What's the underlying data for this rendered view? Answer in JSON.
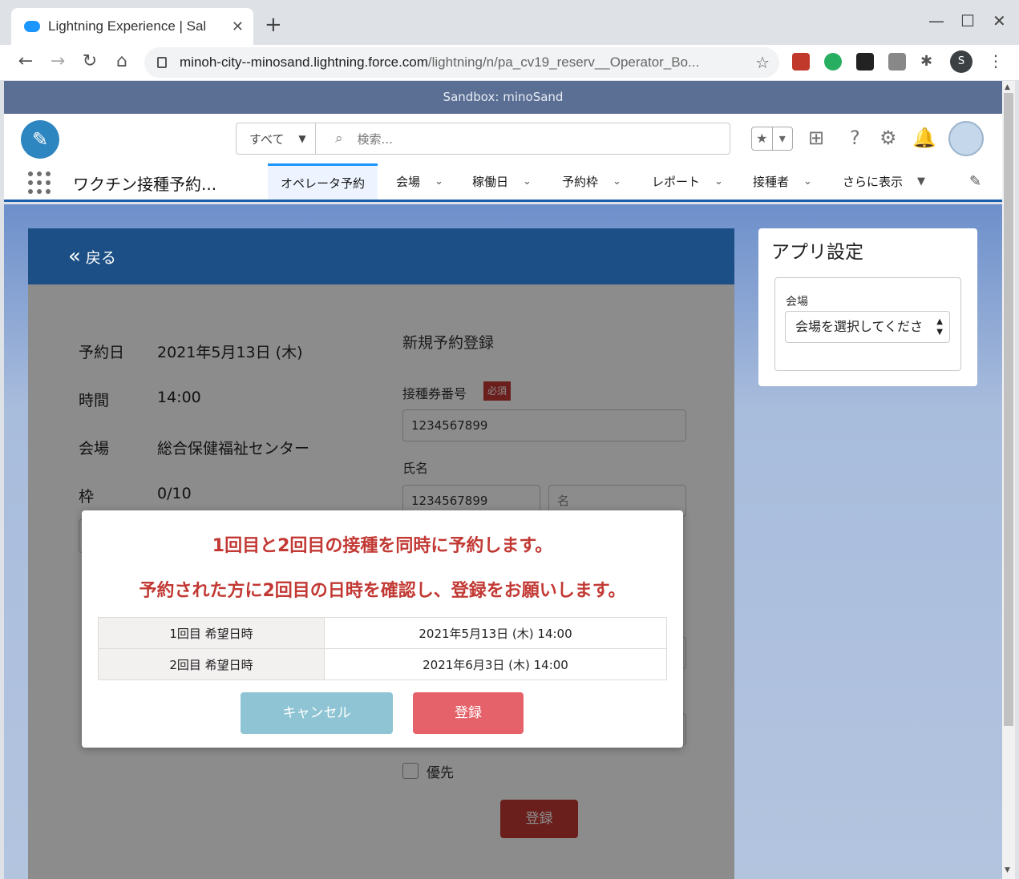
{
  "browser": {
    "tab_title": "Lightning Experience | Sal",
    "url_host": "minoh-city--minosand.lightning.force.com",
    "url_path": "/lightning/n/pa_cv19_reserv__Operator_Bo...",
    "profile_initial": "S"
  },
  "sandbox_banner": "Sandbox: minoSand",
  "header": {
    "search_scope": "すべて",
    "search_placeholder": "検索..."
  },
  "nav": {
    "app_name": "ワクチン接種予約...",
    "items": [
      {
        "label": "オペレータ予約"
      },
      {
        "label": "会場"
      },
      {
        "label": "稼働日"
      },
      {
        "label": "予約枠"
      },
      {
        "label": "レポート"
      },
      {
        "label": "接種者"
      },
      {
        "label": "さらに表示"
      }
    ]
  },
  "main": {
    "back_label": "戻る",
    "rows": [
      {
        "label": "予約日",
        "value": "2021年5月13日 (木)"
      },
      {
        "label": "時間",
        "value": "14:00"
      },
      {
        "label": "会場",
        "value": "総合保健福祉センター"
      },
      {
        "label": "枠",
        "value": "0/10"
      }
    ],
    "form_title": "新規予約登録",
    "ticket_label": "接種券番号",
    "required_badge": "必須",
    "ticket_value": "1234567899",
    "name_label": "氏名",
    "last_name_value": "1234567899",
    "first_name_placeholder": "名",
    "priority_label": "優先",
    "submit_label": "登録"
  },
  "side": {
    "title": "アプリ設定",
    "venue_label": "会場",
    "venue_select": "会場を選択してくださ"
  },
  "modal": {
    "message_1": "1回目と2回目の接種を同時に予約します。",
    "message_2": "予約された方に2回目の日時を確認し、登録をお願いします。",
    "rows": [
      {
        "label": "1回目 希望日時",
        "value": "2021年5月13日 (木) 14:00"
      },
      {
        "label": "2回目 希望日時",
        "value": "2021年6月3日 (木) 14:00"
      }
    ],
    "cancel_label": "キャンセル",
    "register_label": "登録"
  },
  "colors": {
    "sandbox_bar": "#5a6f93",
    "card_header": "#1b4f85",
    "error_text": "#c23934",
    "cancel_button": "#8ec4d3",
    "register_button": "#e5626a"
  }
}
